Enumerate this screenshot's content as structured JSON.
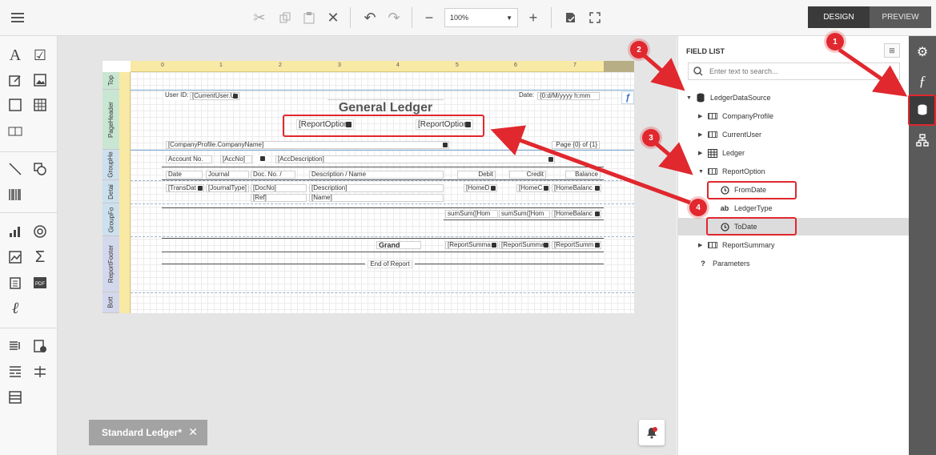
{
  "toolbar": {
    "zoom_value": "100%",
    "mode_design": "DESIGN",
    "mode_preview": "PREVIEW"
  },
  "report": {
    "ruler_numbers": [
      "0",
      "1",
      "2",
      "3",
      "4",
      "5",
      "6",
      "7"
    ],
    "bands": [
      "Top",
      "PageHeader",
      "GroupHe",
      "Detai",
      "GroupFo",
      "ReportFooter",
      "Bott"
    ],
    "user_id_label": "User ID:",
    "user_id_value": "[CurrentUser.U",
    "date_label": "Date:",
    "date_value": "{0:d/M/yyyy h:mm",
    "title": "General Ledger",
    "report_option_1": "[ReportOption",
    "report_option_2": "[ReportOption",
    "company_name": "[CompanyProfile.CompanyName]",
    "page_info": "Page {0} of {1}",
    "account_no_label": "Account No.",
    "acc_no": "[AccNo]",
    "acc_description": "[AccDescription]",
    "col_headers": [
      "Date",
      "Journal",
      "Doc. No. /",
      "Description / Name",
      "Debit",
      "Credit",
      "Balance"
    ],
    "detail_cells": [
      "[TransDat",
      "[JournalType]",
      "[DocNo]",
      "[Description]",
      "[HomeD",
      "[HomeC",
      "[HomeBalanc"
    ],
    "ref": "[Ref]",
    "name": "[Name]",
    "sum_cells": [
      "sumSum([Hom",
      "sumSum([Hom",
      "[HomeBalanc"
    ],
    "grand_label": "Grand",
    "summary_cells": [
      "[ReportSumma",
      "[ReportSumma",
      "[ReportSumm"
    ],
    "end_of_report": "End of Report"
  },
  "doc_tab": {
    "label": "Standard Ledger*"
  },
  "field_list": {
    "title": "FIELD LIST",
    "search_placeholder": "Enter text to search...",
    "root": "LedgerDataSource",
    "items": [
      {
        "label": "CompanyProfile",
        "icon": "table-icon"
      },
      {
        "label": "CurrentUser",
        "icon": "table-icon"
      },
      {
        "label": "Ledger",
        "icon": "grid-icon"
      },
      {
        "label": "ReportOption",
        "icon": "table-icon"
      },
      {
        "label": "FromDate",
        "icon": "clock-icon"
      },
      {
        "label": "LedgerType",
        "icon": "text-icon"
      },
      {
        "label": "ToDate",
        "icon": "clock-icon"
      },
      {
        "label": "ReportSummary",
        "icon": "table-icon"
      },
      {
        "label": "Parameters",
        "icon": "question-icon"
      }
    ],
    "text_icon_label": "ab",
    "params_icon_label": "?"
  },
  "annotations": [
    "1",
    "2",
    "3",
    "4"
  ],
  "colors": {
    "accent_red": "#e0282e",
    "ruler": "#f8e9a4",
    "right_bar": "#5a5a5a"
  }
}
